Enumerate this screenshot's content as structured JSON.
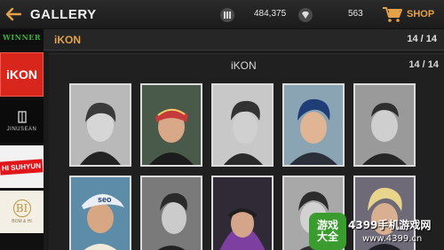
{
  "header": {
    "title": "GALLERY",
    "currency_1": "484,375",
    "currency_2": "563",
    "shop_label": "SHOP",
    "accent": "#e3a24a"
  },
  "sidebar": {
    "items": [
      {
        "label": "WINNER",
        "selected": false
      },
      {
        "label": "iKON",
        "selected": true
      },
      {
        "label": "JINUSEAN",
        "selected": false
      },
      {
        "label": "HI SUHYUN",
        "selected": false
      },
      {
        "label": "BOM & HI",
        "selected": false
      }
    ]
  },
  "group_header": {
    "name": "iKON",
    "count": "14 / 14"
  },
  "panel": {
    "name": "iKON",
    "count": "14 / 14"
  },
  "photo_cards": [
    {
      "icon": "member-photo-grayscale"
    },
    {
      "icon": "member-photo-bandana"
    },
    {
      "icon": "member-photo-grayscale"
    },
    {
      "icon": "member-photo-blue-hair"
    },
    {
      "icon": "member-photo-grayscale"
    },
    {
      "icon": "member-photo-cap"
    },
    {
      "icon": "member-photo-grayscale"
    },
    {
      "icon": "member-photo-hood"
    },
    {
      "icon": "member-photo-grayscale"
    },
    {
      "icon": "member-photo-blond"
    }
  ],
  "watermark": {
    "badge_line1": "游戏",
    "badge_line2": "大全",
    "text_line1": "4399手机游戏网",
    "text_line2": "www.4399.cn"
  }
}
